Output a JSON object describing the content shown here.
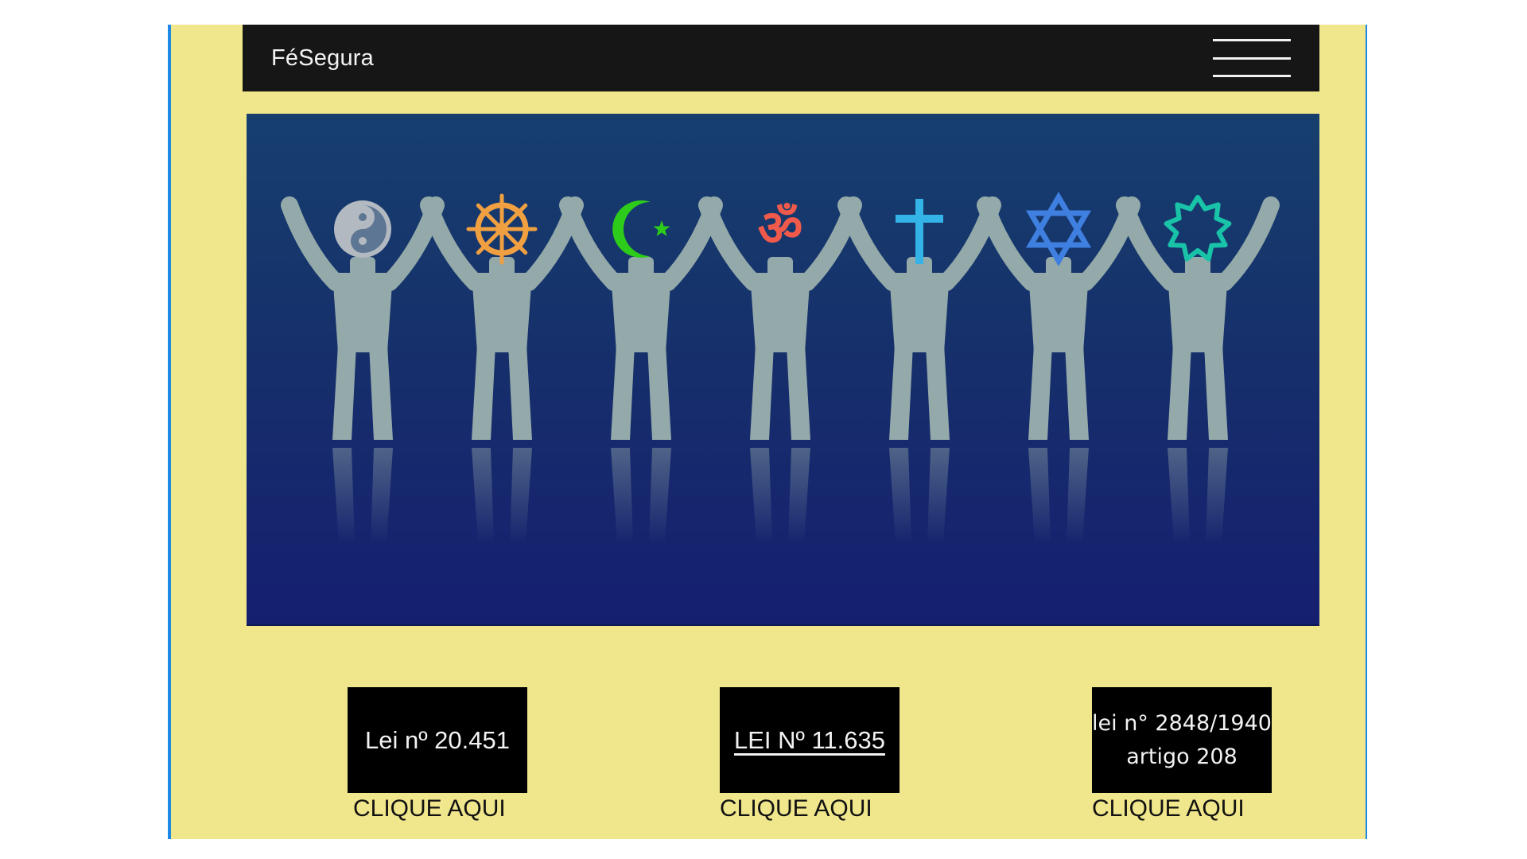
{
  "navbar": {
    "brand": "FéSegura",
    "menu_icon": "hamburger-menu-icon"
  },
  "hero": {
    "image_subject": "interfaith-people-holding-hands",
    "symbols": [
      {
        "icon": "yin-yang-icon",
        "color": "#b3b9c0"
      },
      {
        "icon": "dharma-wheel-icon",
        "color": "#f0a040"
      },
      {
        "icon": "star-crescent-icon",
        "color": "#2ecc1a"
      },
      {
        "icon": "om-icon",
        "color": "#f05a4a"
      },
      {
        "icon": "christian-cross-icon",
        "color": "#33b3e6"
      },
      {
        "icon": "star-of-david-icon",
        "color": "#3e7fe0"
      },
      {
        "icon": "bahai-star-icon",
        "color": "#18c3a8"
      }
    ],
    "figure_color": "#94a9a9"
  },
  "laws": [
    {
      "title": "Lei nº 20.451",
      "cta": "CLIQUE AQUI"
    },
    {
      "title": "LEI Nº 11.635",
      "cta": "CLIQUE AQUI"
    },
    {
      "title_line1": "lei n° 2848/1940",
      "title_line2": "artigo 208",
      "cta": "CLIQUE AQUI"
    }
  ],
  "colors": {
    "page_bg": "#f0e68c",
    "navbar_bg": "#161616",
    "accent_border": "#1e88e5",
    "card_bg": "#000000"
  }
}
